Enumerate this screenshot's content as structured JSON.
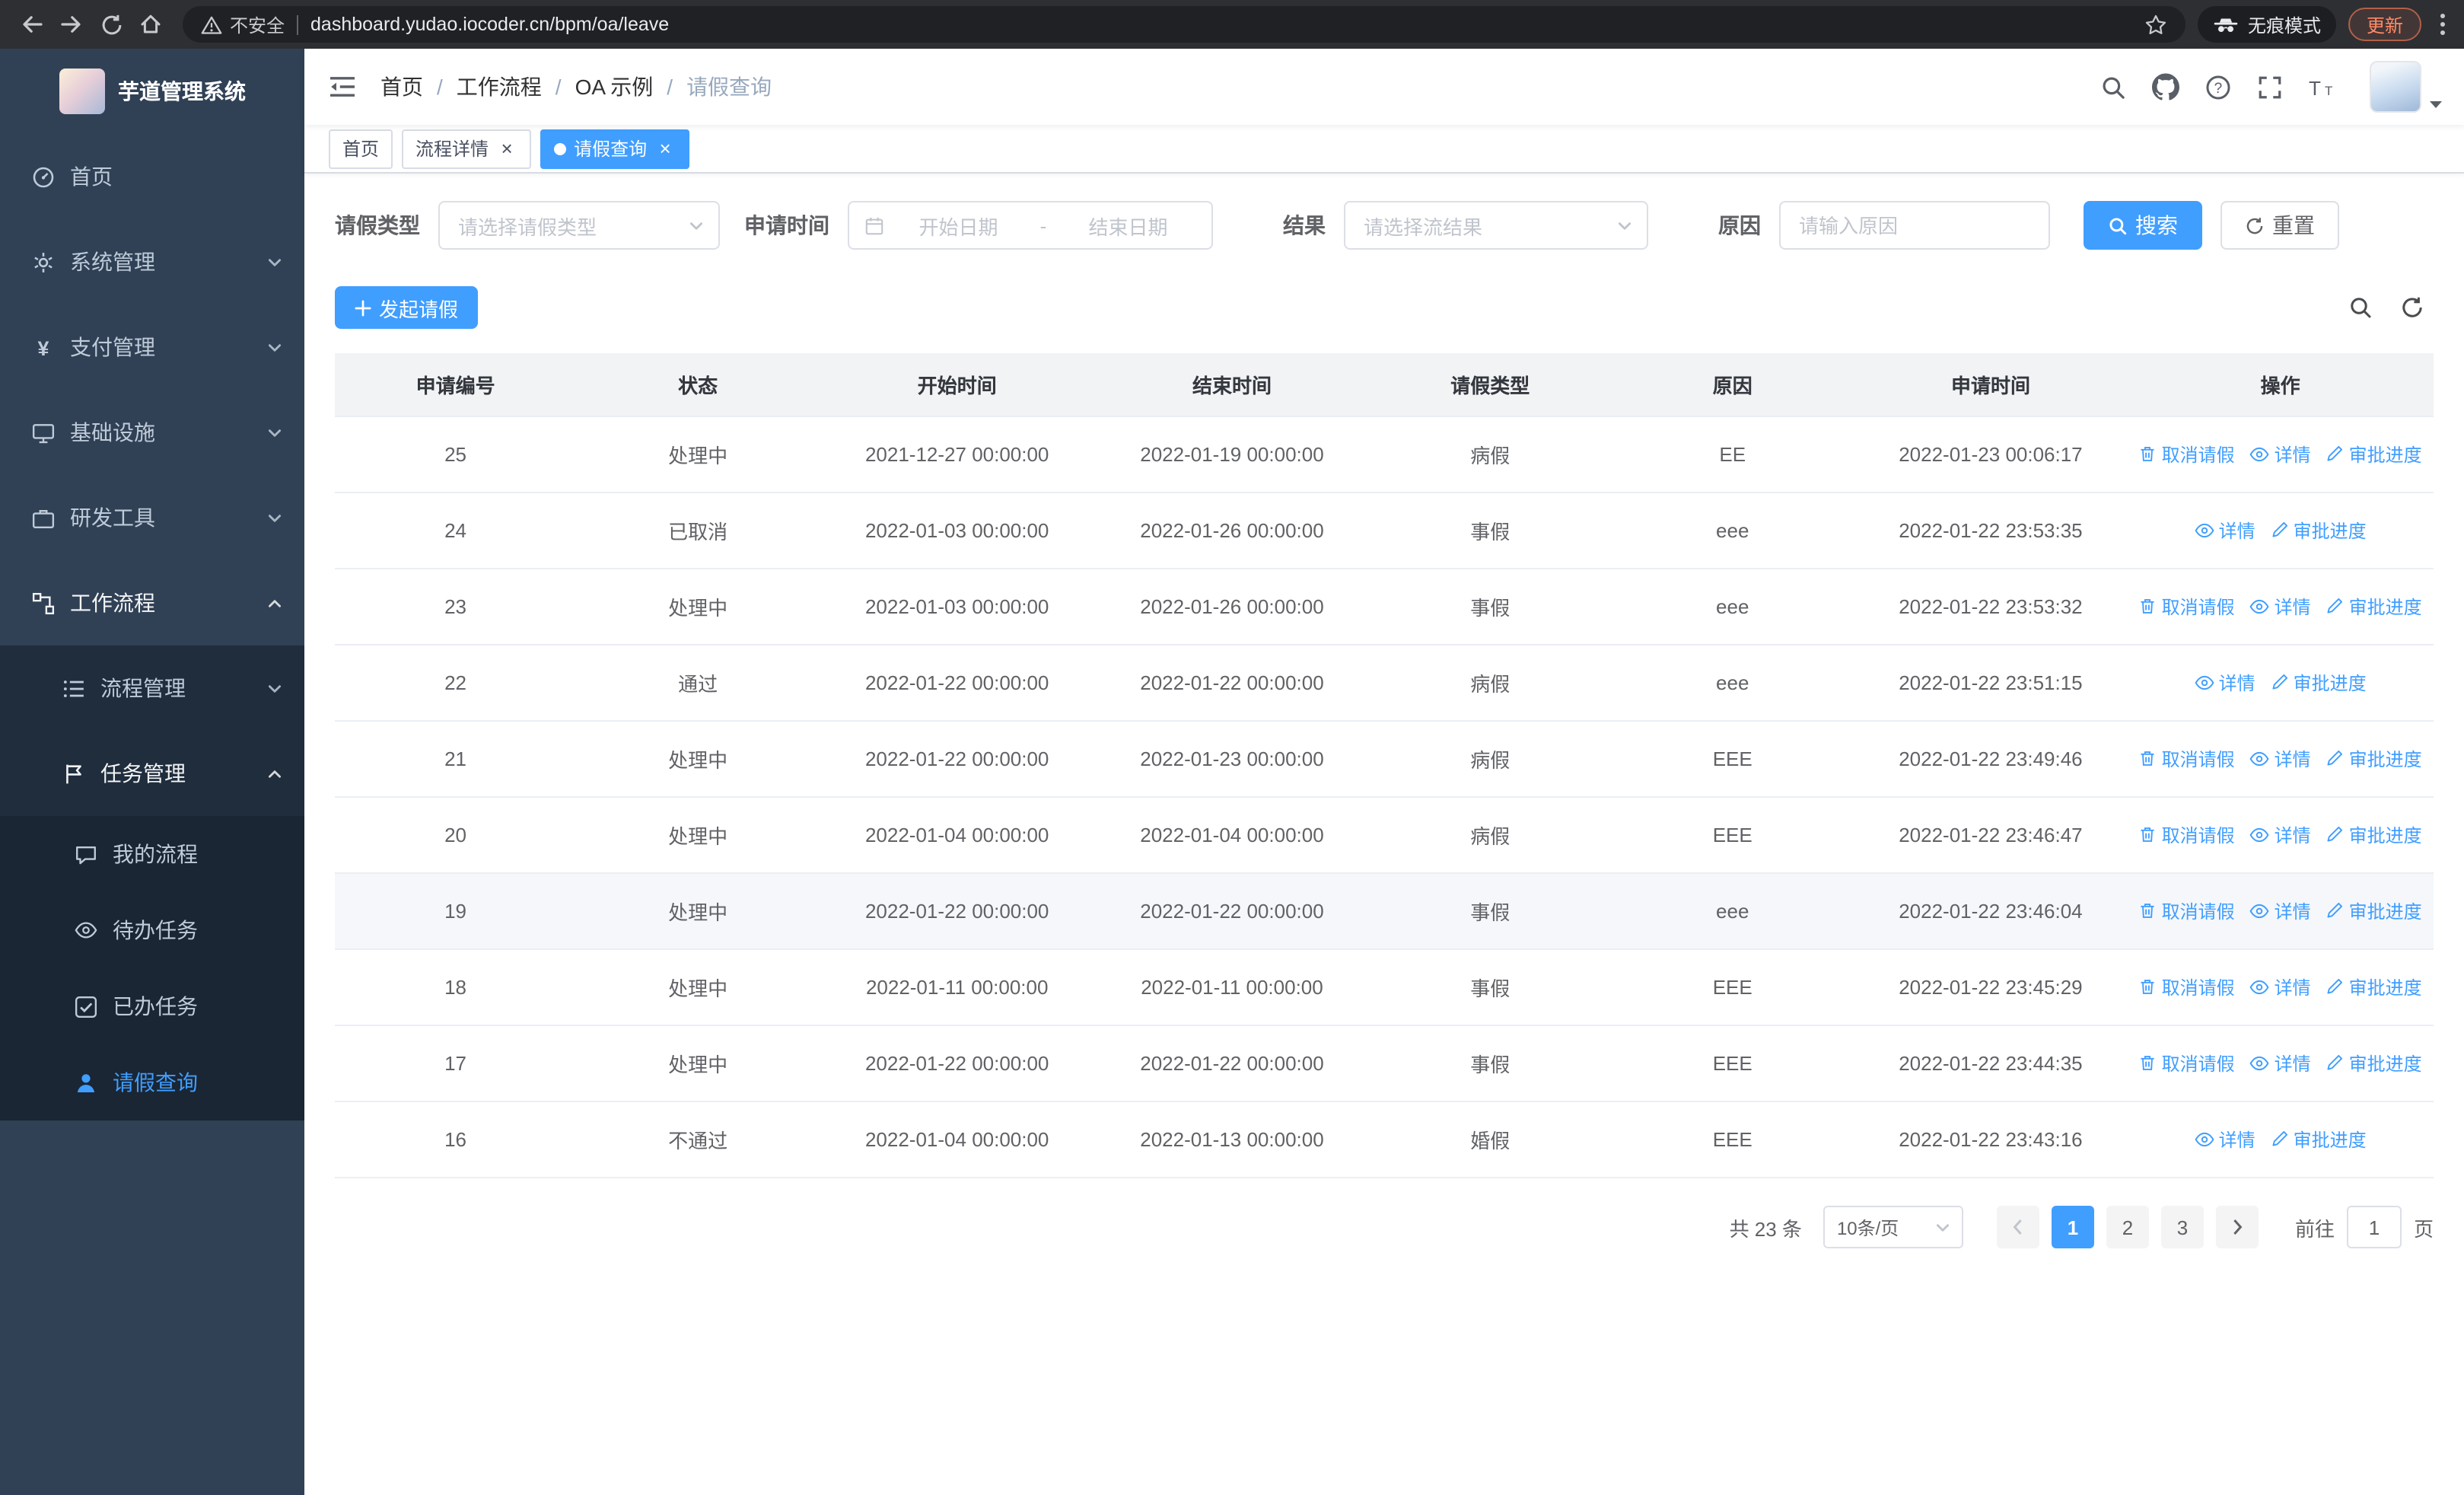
{
  "browser": {
    "warning_label": "不安全",
    "url": "dashboard.yudao.iocoder.cn/bpm/oa/leave",
    "incognito_label": "无痕模式",
    "update_label": "更新"
  },
  "sidebar": {
    "logo_title": "芋道管理系统",
    "items": [
      {
        "label": "首页",
        "icon": "dashboard-icon",
        "level": 1
      },
      {
        "label": "系统管理",
        "icon": "gear-icon",
        "level": 1,
        "chevron": "down"
      },
      {
        "label": "支付管理",
        "icon": "payment-icon",
        "level": 1,
        "chevron": "down"
      },
      {
        "label": "基础设施",
        "icon": "infrastructure-icon",
        "level": 1,
        "chevron": "down"
      },
      {
        "label": "研发工具",
        "icon": "devtools-icon",
        "level": 1,
        "chevron": "down"
      },
      {
        "label": "工作流程",
        "icon": "workflow-icon",
        "level": 1,
        "chevron": "up",
        "open": true
      },
      {
        "label": "流程管理",
        "icon": "process-icon",
        "level": 2,
        "chevron": "down"
      },
      {
        "label": "任务管理",
        "icon": "task-icon",
        "level": 2,
        "chevron": "up",
        "open": true
      },
      {
        "label": "我的流程",
        "icon": "message-icon",
        "level": 3
      },
      {
        "label": "待办任务",
        "icon": "eye-icon",
        "level": 3
      },
      {
        "label": "已办任务",
        "icon": "done-icon",
        "level": 3
      },
      {
        "label": "请假查询",
        "icon": "user-icon",
        "level": 3,
        "active": true
      }
    ]
  },
  "header": {
    "breadcrumb": [
      "首页",
      "工作流程",
      "OA 示例",
      "请假查询"
    ],
    "separator": "/"
  },
  "tabs": [
    {
      "label": "首页",
      "closable": false,
      "active": false
    },
    {
      "label": "流程详情",
      "closable": true,
      "active": false
    },
    {
      "label": "请假查询",
      "closable": true,
      "active": true
    }
  ],
  "filters": {
    "leave_type_label": "请假类型",
    "leave_type_placeholder": "请选择请假类型",
    "apply_time_label": "申请时间",
    "start_date_placeholder": "开始日期",
    "date_separator": "-",
    "end_date_placeholder": "结束日期",
    "result_label": "结果",
    "result_placeholder": "请选择流结果",
    "reason_label": "原因",
    "reason_placeholder": "请输入原因",
    "search_label": "搜索",
    "reset_label": "重置"
  },
  "toolbar": {
    "create_label": "发起请假"
  },
  "table": {
    "columns": [
      "申请编号",
      "状态",
      "开始时间",
      "结束时间",
      "请假类型",
      "原因",
      "申请时间",
      "操作"
    ],
    "action_defs": {
      "cancel": {
        "label": "取消请假",
        "icon": "delete-icon",
        "name": "cancel-leave-link"
      },
      "detail": {
        "label": "详情",
        "icon": "view-icon",
        "name": "detail-link"
      },
      "progress": {
        "label": "审批进度",
        "icon": "edit-icon",
        "name": "approval-progress-link"
      }
    },
    "rows": [
      {
        "id": "25",
        "status": "处理中",
        "start_time": "2021-12-27 00:00:00",
        "end_time": "2022-01-19 00:00:00",
        "leave_type": "病假",
        "reason": "EE",
        "apply_time": "2022-01-23 00:06:17",
        "actions": [
          "cancel",
          "detail",
          "progress"
        ]
      },
      {
        "id": "24",
        "status": "已取消",
        "start_time": "2022-01-03 00:00:00",
        "end_time": "2022-01-26 00:00:00",
        "leave_type": "事假",
        "reason": "eee",
        "apply_time": "2022-01-22 23:53:35",
        "actions": [
          "detail",
          "progress"
        ]
      },
      {
        "id": "23",
        "status": "处理中",
        "start_time": "2022-01-03 00:00:00",
        "end_time": "2022-01-26 00:00:00",
        "leave_type": "事假",
        "reason": "eee",
        "apply_time": "2022-01-22 23:53:32",
        "actions": [
          "cancel",
          "detail",
          "progress"
        ]
      },
      {
        "id": "22",
        "status": "通过",
        "start_time": "2022-01-22 00:00:00",
        "end_time": "2022-01-22 00:00:00",
        "leave_type": "病假",
        "reason": "eee",
        "apply_time": "2022-01-22 23:51:15",
        "actions": [
          "detail",
          "progress"
        ]
      },
      {
        "id": "21",
        "status": "处理中",
        "start_time": "2022-01-22 00:00:00",
        "end_time": "2022-01-23 00:00:00",
        "leave_type": "病假",
        "reason": "EEE",
        "apply_time": "2022-01-22 23:49:46",
        "actions": [
          "cancel",
          "detail",
          "progress"
        ]
      },
      {
        "id": "20",
        "status": "处理中",
        "start_time": "2022-01-04 00:00:00",
        "end_time": "2022-01-04 00:00:00",
        "leave_type": "病假",
        "reason": "EEE",
        "apply_time": "2022-01-22 23:46:47",
        "actions": [
          "cancel",
          "detail",
          "progress"
        ]
      },
      {
        "id": "19",
        "status": "处理中",
        "start_time": "2022-01-22 00:00:00",
        "end_time": "2022-01-22 00:00:00",
        "leave_type": "事假",
        "reason": "eee",
        "apply_time": "2022-01-22 23:46:04",
        "actions": [
          "cancel",
          "detail",
          "progress"
        ],
        "hover": true
      },
      {
        "id": "18",
        "status": "处理中",
        "start_time": "2022-01-11 00:00:00",
        "end_time": "2022-01-11 00:00:00",
        "leave_type": "事假",
        "reason": "EEE",
        "apply_time": "2022-01-22 23:45:29",
        "actions": [
          "cancel",
          "detail",
          "progress"
        ]
      },
      {
        "id": "17",
        "status": "处理中",
        "start_time": "2022-01-22 00:00:00",
        "end_time": "2022-01-22 00:00:00",
        "leave_type": "事假",
        "reason": "EEE",
        "apply_time": "2022-01-22 23:44:35",
        "actions": [
          "cancel",
          "detail",
          "progress"
        ]
      },
      {
        "id": "16",
        "status": "不通过",
        "start_time": "2022-01-04 00:00:00",
        "end_time": "2022-01-13 00:00:00",
        "leave_type": "婚假",
        "reason": "EEE",
        "apply_time": "2022-01-22 23:43:16",
        "actions": [
          "detail",
          "progress"
        ]
      }
    ]
  },
  "pagination": {
    "total_label": "共 23 条",
    "page_size_value": "10条/页",
    "pages": [
      "1",
      "2",
      "3"
    ],
    "active_page": "1",
    "goto_label": "前往",
    "goto_value": "1",
    "goto_unit": "页"
  },
  "colors": {
    "primary": "#409eff",
    "sidebar_bg": "#304156",
    "submenu_bg": "#1f2d3d",
    "table_header_bg": "#f2f3f5"
  }
}
